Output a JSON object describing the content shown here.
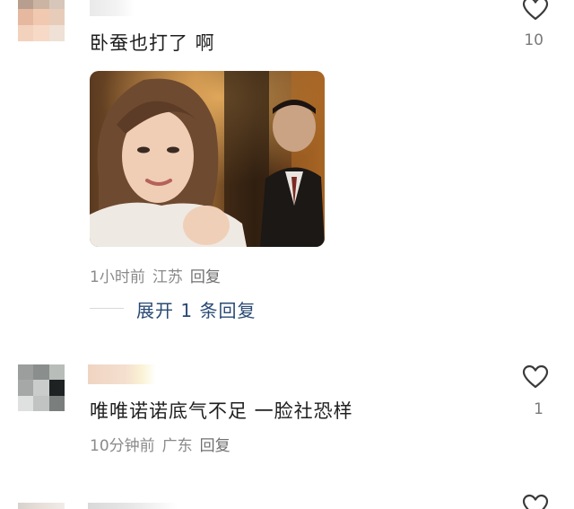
{
  "comments": [
    {
      "text": "卧蚕也打了 啊",
      "likes": "10",
      "time": "1小时前",
      "location": "江苏",
      "reply_label": "回复",
      "expand_label": "展开 1 条回复"
    },
    {
      "text": "唯唯诺诺底气不足 一脸社恐样",
      "likes": "1",
      "time": "10分钟前",
      "location": "广东",
      "reply_label": "回复"
    }
  ],
  "icons": {
    "like": "heart-outline-icon"
  },
  "colors": {
    "text_primary": "#1f1f1f",
    "meta": "#8a8a8a",
    "expand_link": "#2a4a74",
    "icon_stroke": "#3a3a3a"
  }
}
